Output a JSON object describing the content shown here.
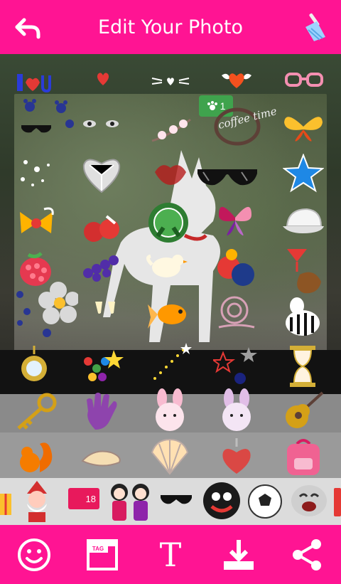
{
  "header": {
    "title": "Edit Your Photo",
    "back_icon": "back-arrow-icon",
    "clean_icon": "broom-icon"
  },
  "canvas": {
    "photo_badge_count": "1",
    "coffee_text": "coffee time"
  },
  "sticker_tray": {
    "tag_badge_count": "18"
  },
  "toolbar": {
    "items": [
      {
        "name": "sticker-tool",
        "icon": "smiley-icon"
      },
      {
        "name": "tag-tool",
        "icon": "tag-frame-icon",
        "label": "TAG"
      },
      {
        "name": "text-tool",
        "icon": "text-icon",
        "label": "T"
      },
      {
        "name": "save-tool",
        "icon": "download-icon"
      },
      {
        "name": "share-tool",
        "icon": "share-icon"
      }
    ]
  },
  "colors": {
    "brand": "#ff1493",
    "toolbar_icon": "#ffffff"
  }
}
